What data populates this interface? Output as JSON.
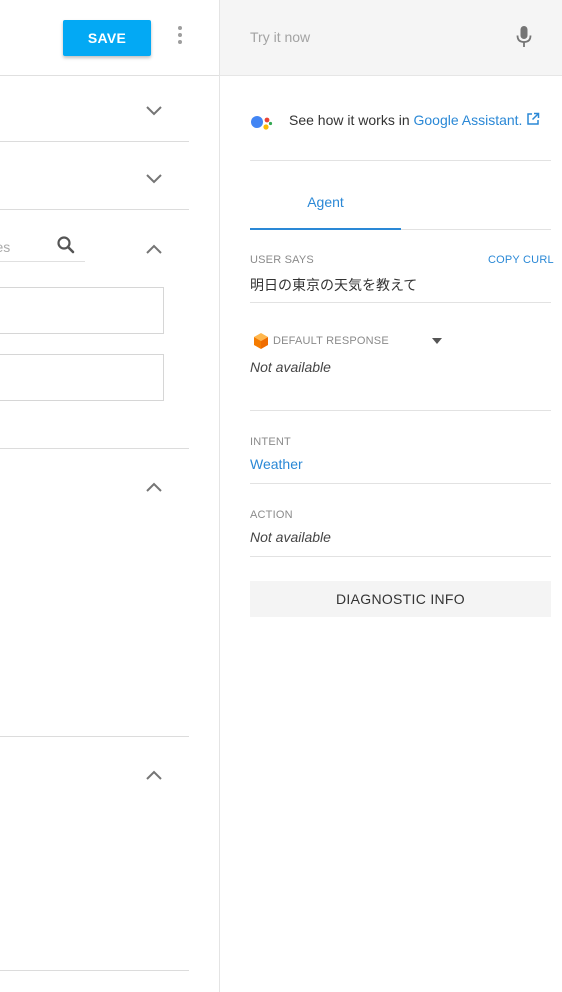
{
  "toolbar": {
    "save_label": "SAVE"
  },
  "left": {
    "search_placeholder": "rases"
  },
  "try_it": {
    "placeholder": "Try it now"
  },
  "assistant": {
    "prefix": "See how it works in ",
    "link": "Google Assistant."
  },
  "tabs": [
    {
      "label": "Agent"
    }
  ],
  "user_says": {
    "label": "USER SAYS",
    "copy_label": "COPY CURL",
    "value": "明日の東京の天気を教えて"
  },
  "default_response": {
    "label": "DEFAULT RESPONSE",
    "value": "Not available"
  },
  "intent": {
    "label": "INTENT",
    "value": "Weather"
  },
  "action": {
    "label": "ACTION",
    "value": "Not available"
  },
  "diagnostic": {
    "label": "DIAGNOSTIC INFO"
  },
  "colors": {
    "accent": "#03a9f4",
    "link": "#2a88d6",
    "panel_bg": "#f5f5f5"
  },
  "icons": [
    "more-vert-icon",
    "chevron-down-icon",
    "chevron-up-icon",
    "search-icon",
    "mic-icon",
    "google-assistant-icon",
    "external-link-icon",
    "cube-icon",
    "caret-down-icon"
  ]
}
